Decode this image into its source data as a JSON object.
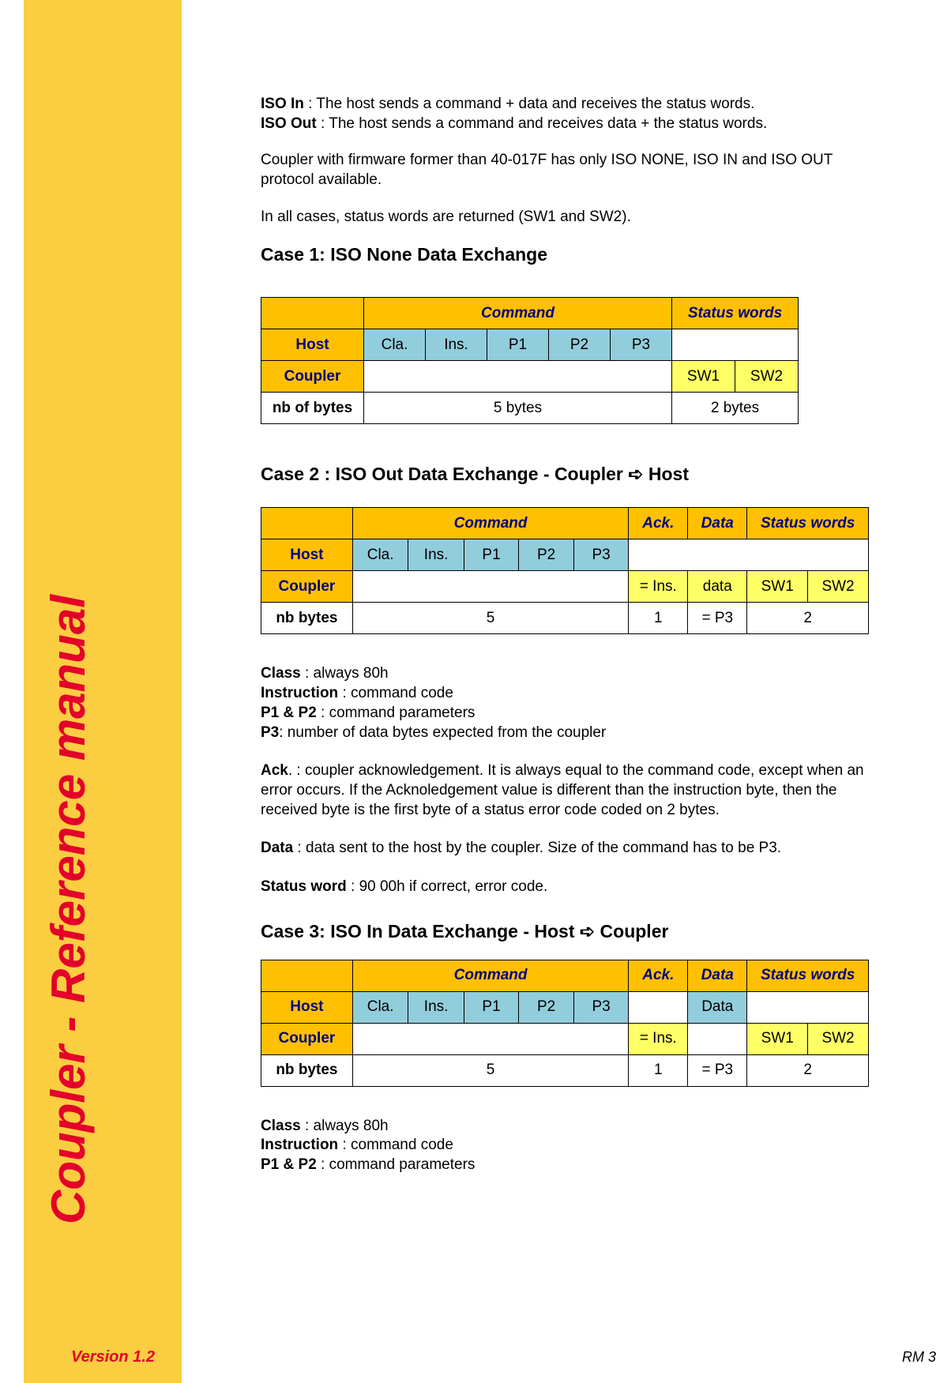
{
  "sidebar": {
    "title": "Coupler - Reference manual",
    "version": "Version 1.2"
  },
  "intro": {
    "iso_in_label": "ISO In",
    "iso_in_text": " : The host sends a command + data and receives the status words.",
    "iso_out_label": "ISO Out",
    "iso_out_text": " : The host sends a command and receives data + the status words.",
    "firmware": "Coupler with firmware former than 40-017F has only ISO NONE, ISO IN and ISO OUT protocol available.",
    "status": "In all cases, status words are returned (SW1 and SW2)."
  },
  "case1": {
    "heading": "Case 1: ISO None Data Exchange",
    "hdr_command": "Command",
    "hdr_status": "Status words",
    "row_host": "Host",
    "row_coupler": "Coupler",
    "row_nb": "nb of bytes",
    "cla": "Cla.",
    "ins": "Ins.",
    "p1": "P1",
    "p2": "P2",
    "p3": "P3",
    "sw1": "SW1",
    "sw2": "SW2",
    "nb_cmd": "5 bytes",
    "nb_sw": "2 bytes"
  },
  "case2": {
    "heading": "Case 2 : ISO Out Data Exchange - Coupler ➪ Host",
    "hdr_command": "Command",
    "hdr_ack": "Ack.",
    "hdr_data": "Data",
    "hdr_status": "Status words",
    "row_host": "Host",
    "row_coupler": "Coupler",
    "row_nb": "nb bytes",
    "cla": "Cla.",
    "ins": "Ins.",
    "p1": "P1",
    "p2": "P2",
    "p3": "P3",
    "eq_ins": "= Ins.",
    "data": "data",
    "sw1": "SW1",
    "sw2": "SW2",
    "nb_cmd": "5",
    "nb_ack": "1",
    "nb_data": "= P3",
    "nb_sw": "2",
    "defs": {
      "class_l": "Class",
      "class_t": " : always 80h",
      "inst_l": "Instruction",
      "inst_t": " : command code",
      "p12_l": "P1 & P2",
      "p12_t": " : command parameters",
      "p3_l": "P3",
      "p3_t": ": number of data bytes expected from the coupler",
      "ack_l": "Ack",
      "ack_t": ". : coupler acknowledgement. It is always equal to the command code, except when an error occurs. If the Acknoledgement value is different than the instruction byte, then the received byte is the first byte of a status error code coded on 2 bytes.",
      "data_l": "Data",
      "data_t": " : data sent to the host by the coupler. Size of the command has to be P3.",
      "sw_l": "Status word",
      "sw_t": " : 90 00h if correct, error code."
    }
  },
  "case3": {
    "heading": "Case 3: ISO In Data Exchange - Host ➪ Coupler",
    "hdr_command": "Command",
    "hdr_ack": "Ack.",
    "hdr_data": "Data",
    "hdr_status": "Status words",
    "row_host": "Host",
    "row_coupler": "Coupler",
    "row_nb": "nb bytes",
    "cla": "Cla.",
    "ins": "Ins.",
    "p1": "P1",
    "p2": "P2",
    "p3": "P3",
    "host_data": "Data",
    "eq_ins": "= Ins.",
    "sw1": "SW1",
    "sw2": "SW2",
    "nb_cmd": "5",
    "nb_ack": "1",
    "nb_data": "= P3",
    "nb_sw": "2",
    "defs": {
      "class_l": "Class",
      "class_t": " : always 80h",
      "inst_l": "Instruction",
      "inst_t": " : command code",
      "p12_l": "P1 & P2",
      "p12_t": " : command parameters"
    }
  },
  "footer": {
    "page": "RM 3"
  }
}
